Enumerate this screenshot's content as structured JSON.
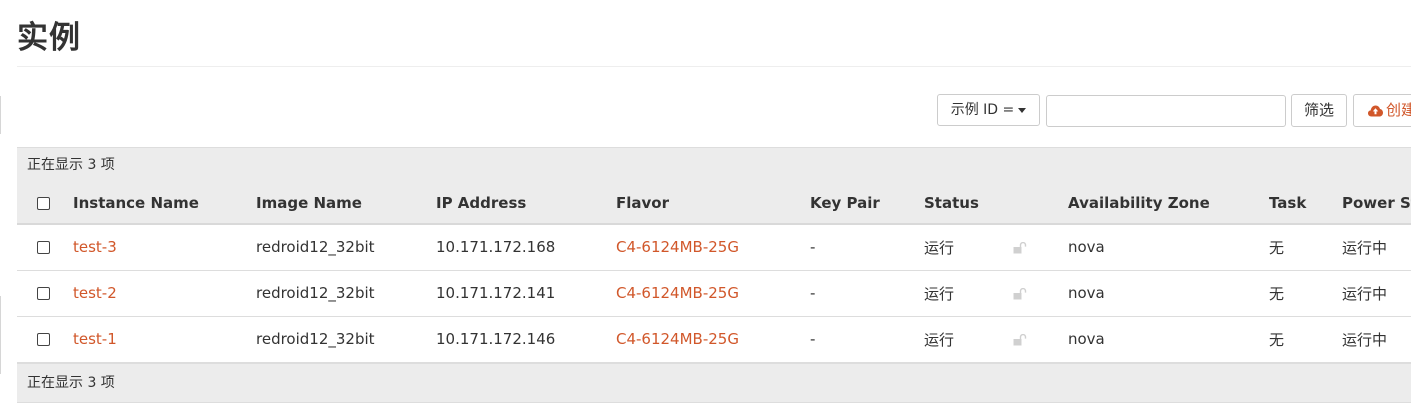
{
  "page": {
    "title": "实例"
  },
  "filter": {
    "field_label": "示例 ID =",
    "input_value": "",
    "filter_button": "筛选",
    "create_button": "创建"
  },
  "table": {
    "count_text": "正在显示 3 项",
    "columns": [
      "Instance Name",
      "Image Name",
      "IP Address",
      "Flavor",
      "Key Pair",
      "Status",
      "",
      "Availability Zone",
      "Task",
      "Power State"
    ],
    "rows": [
      {
        "name": "test-3",
        "image": "redroid12_32bit",
        "ip": "10.171.172.168",
        "flavor": "C4-6124MB-25G",
        "keypair": "-",
        "status": "运行",
        "zone": "nova",
        "task": "无",
        "power": "运行中"
      },
      {
        "name": "test-2",
        "image": "redroid12_32bit",
        "ip": "10.171.172.141",
        "flavor": "C4-6124MB-25G",
        "keypair": "-",
        "status": "运行",
        "zone": "nova",
        "task": "无",
        "power": "运行中"
      },
      {
        "name": "test-1",
        "image": "redroid12_32bit",
        "ip": "10.171.172.146",
        "flavor": "C4-6124MB-25G",
        "keypair": "-",
        "status": "运行",
        "zone": "nova",
        "task": "无",
        "power": "运行中"
      }
    ]
  },
  "icons": {
    "create": "cloud-upload-icon",
    "lock": "unlocked-icon",
    "caret": "caret-down-icon"
  },
  "colors": {
    "accent": "#d1572a",
    "header_bg": "#ececec"
  }
}
